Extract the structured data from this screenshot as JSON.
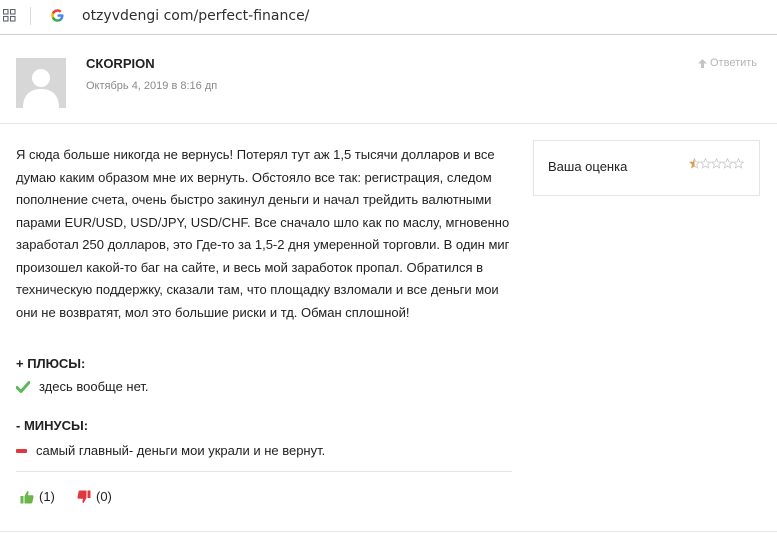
{
  "browser": {
    "url": "otzyvdengi com/perfect-finance/"
  },
  "review": {
    "author": "СКORPION",
    "date": "Октябрь 4, 2019 в 8:16 дп",
    "reply_label": "Ответить",
    "text": "Я сюда больше никогда не вернусь! Потерял тут аж 1,5 тысячи долларов и все думаю каким образом мне их вернуть. Обстояло все так: регистрация, следом пополнение счета, очень быстро закинул деньги и начал трейдить валютными парами EUR/USD, USD/JPY, USD/CHF. Все сначало шло как по маслу, мгновенно заработал 250 долларов, это Где-то за 1,5-2 дня умеренной торговли. В один миг произошел какой-то баг на сайте, и весь мой заработок пропал. Обратился в техническую поддержку, сказали там, что площадку взломали и все деньги мои они не возвратят, мол это большие риски и тд. Обман сплошной!",
    "rating": {
      "label": "Ваша оценка",
      "value": 0.5,
      "max": 5,
      "star_color": "#e09a3e"
    },
    "pros": {
      "title": "+ ПЛЮСЫ:",
      "items": [
        "здесь вообще нет."
      ],
      "icon": "check-icon",
      "color": "#5cb85c"
    },
    "cons": {
      "title": "- МИНУСЫ:",
      "items": [
        "самый главный- деньги мои украли и не вернут."
      ],
      "icon": "minus-icon",
      "color": "#e0383e"
    },
    "votes": {
      "likes": "(1)",
      "dislikes": "(0)",
      "like_color": "#6bb64a",
      "dislike_color": "#e0383e"
    }
  }
}
